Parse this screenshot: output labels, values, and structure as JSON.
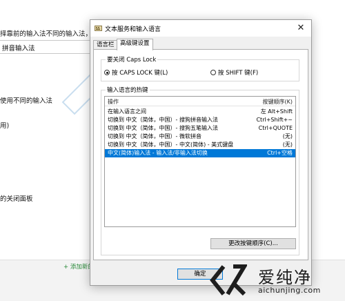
{
  "background": {
    "line1": "择靠前的输入法不同的输入法，请",
    "input_value": "拼音输入法",
    "line2": "使用不同的输入法",
    "line3": "用)",
    "line4": "的关闭面板",
    "add_link": "+ 添加新的"
  },
  "dialog": {
    "title": "文本服务和输入语言",
    "tabs": [
      "语言栏",
      "高级键设置"
    ],
    "caps_group": {
      "label": "要关闭 Caps Lock",
      "option_caps": "按 CAPS LOCK 键(L)",
      "option_shift": "按 SHIFT 键(F)",
      "selected": "caps"
    },
    "hotkey_group": {
      "label": "输入语言的热键",
      "col_action": "操作",
      "col_keys": "按键顺序(K)",
      "rows": [
        {
          "action": "在输入语言之间",
          "keys": "左 Alt+Shift"
        },
        {
          "action": "切换到 中文（简体，中国）- 搜狗拼音输入法",
          "keys": "Ctrl+Shift+~"
        },
        {
          "action": "切换到 中文（简体，中国）- 搜狗五笔输入法",
          "keys": "Ctrl+QUOTE"
        },
        {
          "action": "切换到 中文（简体，中国）- 微软拼音",
          "keys": "(无)"
        },
        {
          "action": "切换到 中文（简体，中国）- 中文(简体) - 美式键盘",
          "keys": "(无)"
        },
        {
          "action": "中文(简体)输入法 - 输入法/非输入法切换",
          "keys": "Ctrl+空格"
        }
      ],
      "selected_row": 5,
      "change_button": "更改按键顺序(C)..."
    },
    "ok_button": "确定"
  },
  "watermark": {
    "logo_cn": "爱纯净",
    "logo_en": "aichunjing.com"
  }
}
